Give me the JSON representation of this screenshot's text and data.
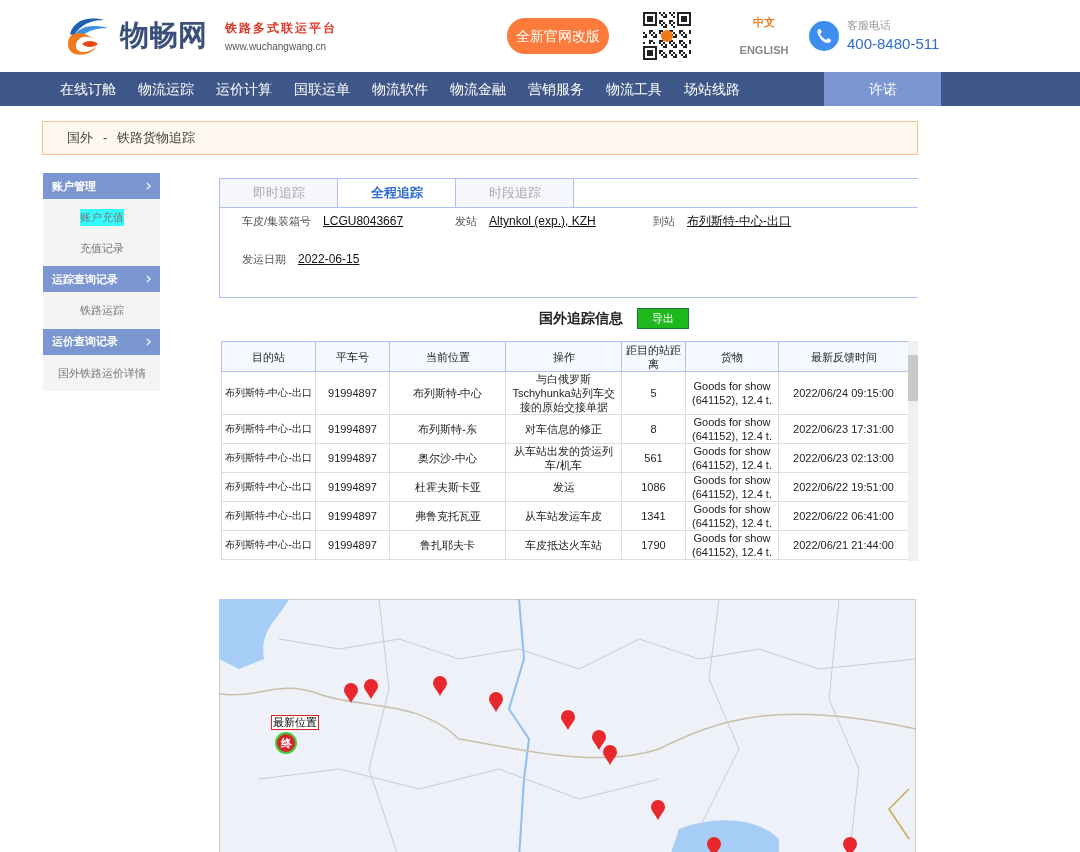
{
  "header": {
    "logo_text": "物畅网",
    "slogan": "铁路多式联运平台",
    "site_url": "www.wuchangwang.cn",
    "promo_button": "全新官网改版",
    "languages": [
      {
        "label": "中文",
        "selected": true
      },
      {
        "label": "ENGLISH",
        "selected": false
      }
    ],
    "hotline_label": "客服电话",
    "hotline_number": "400-8480-511"
  },
  "nav": {
    "items": [
      {
        "label": "在线订舱",
        "selected": false
      },
      {
        "label": "物流运踪",
        "selected": false
      },
      {
        "label": "运价计算",
        "selected": false
      },
      {
        "label": "国联运单",
        "selected": false
      },
      {
        "label": "物流软件",
        "selected": false
      },
      {
        "label": "物流金融",
        "selected": false
      },
      {
        "label": "营销服务",
        "selected": false
      },
      {
        "label": "物流工具",
        "selected": false
      },
      {
        "label": "场站线路",
        "selected": false
      },
      {
        "label": "许诺",
        "selected": true
      }
    ]
  },
  "breadcrumb": [
    "国外",
    "-",
    "铁路货物追踪"
  ],
  "sidebar": {
    "groups": [
      {
        "title": "账户管理",
        "items": [
          {
            "label": "账户充值",
            "selected": true
          },
          {
            "label": "充值记录",
            "selected": false
          }
        ]
      },
      {
        "title": "运踪查询记录",
        "items": [
          {
            "label": "铁路运踪",
            "selected": false
          }
        ]
      },
      {
        "title": "运价查询记录",
        "items": [
          {
            "label": "国外铁路运价详情",
            "selected": false
          }
        ]
      }
    ]
  },
  "tabs": [
    {
      "label": "即时追踪",
      "selected": false
    },
    {
      "label": "全程追踪",
      "selected": true
    },
    {
      "label": "时段追踪",
      "selected": false
    }
  ],
  "query": {
    "fields": [
      {
        "label": "车皮/集装箱号",
        "value": "LCGU8043667"
      },
      {
        "label": "发站",
        "value": "Altynkol (exp.), KZH"
      },
      {
        "label": "到站",
        "value": "布列斯特-中心-出口"
      },
      {
        "label": "发运日期",
        "value": "2022-06-15"
      }
    ]
  },
  "results": {
    "title": "国外追踪信息",
    "export_button": "导出",
    "table": {
      "columns": [
        "目的站",
        "平车号",
        "当前位置",
        "操作",
        "距目的站距离",
        "货物",
        "最新反馈时间"
      ],
      "rows": [
        [
          "布列斯特-中心-出口",
          "91994897",
          "布列斯特-中心",
          "与白俄罗斯Tschyhunka站列车交接的原始交接单据",
          "5",
          "Goods for show (641152), 12.4 t.",
          "2022/06/24 09:15:00"
        ],
        [
          "布列斯特-中心-出口",
          "91994897",
          "布列斯特-东",
          "对车信息的修正",
          "8",
          "Goods for show (641152), 12.4 t.",
          "2022/06/23 17:31:00"
        ],
        [
          "布列斯特-中心-出口",
          "91994897",
          "奥尔沙-中心",
          "从车站出发的货运列车/机车",
          "561",
          "Goods for show (641152), 12.4 t.",
          "2022/06/23 02:13:00"
        ],
        [
          "布列斯特-中心-出口",
          "91994897",
          "杜霍夫斯卡亚",
          "发运",
          "1086",
          "Goods for show (641152), 12.4 t.",
          "2022/06/22 19:51:00"
        ],
        [
          "布列斯特-中心-出口",
          "91994897",
          "弗鲁克托瓦亚",
          "从车站发运车皮",
          "1341",
          "Goods for show (641152), 12.4 t.",
          "2022/06/22 06:41:00"
        ],
        [
          "布列斯特-中心-出口",
          "91994897",
          "鲁扎耶夫卡",
          "车皮抵达火车站",
          "1790",
          "Goods for show (641152), 12.4 t.",
          "2022/06/21 21:44:00"
        ]
      ]
    }
  },
  "map": {
    "latest_label": "最新位置",
    "end_marker": "终"
  }
}
